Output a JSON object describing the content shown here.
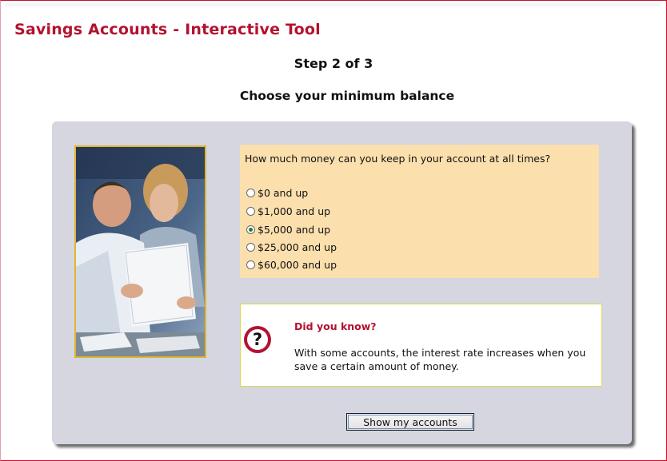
{
  "header": {
    "title": "Savings Accounts - Interactive Tool",
    "step": "Step 2 of 3",
    "subtitle": "Choose your minimum balance"
  },
  "question": {
    "prompt": "How much money can you keep in your account at all times?",
    "options": [
      {
        "label": "$0 and up",
        "selected": false
      },
      {
        "label": "$1,000 and up",
        "selected": false
      },
      {
        "label": "$5,000 and up",
        "selected": true
      },
      {
        "label": "$25,000 and up",
        "selected": false
      },
      {
        "label": "$60,000 and up",
        "selected": false
      }
    ]
  },
  "tip": {
    "icon": "question-mark-icon",
    "title": "Did you know?",
    "text": "With some accounts, the interest rate increases when you save a certain amount of money."
  },
  "actions": {
    "submit_label": "Show my accounts"
  },
  "colors": {
    "brand_red": "#b3122f",
    "panel_gray": "#d5d6df",
    "question_bg": "#fbdfad",
    "photo_border": "#e0b52e"
  }
}
